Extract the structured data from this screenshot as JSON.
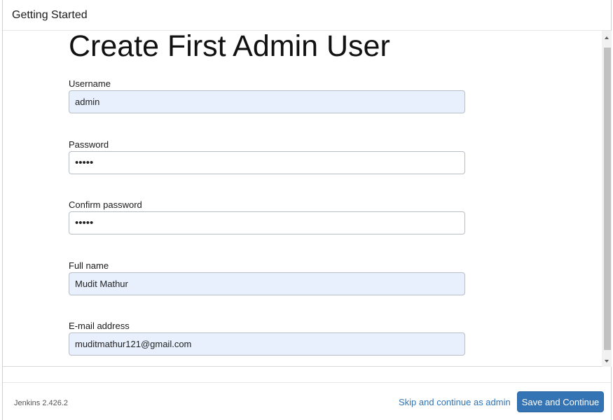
{
  "dialog": {
    "title": "Getting Started"
  },
  "form": {
    "heading": "Create First Admin User",
    "fields": [
      {
        "label": "Username",
        "value": "admin",
        "type": "text"
      },
      {
        "label": "Password",
        "value": "admin",
        "type": "password"
      },
      {
        "label": "Confirm password",
        "value": "admin",
        "type": "password"
      },
      {
        "label": "Full name",
        "value": "Mudit Mathur",
        "type": "text"
      },
      {
        "label": "E-mail address",
        "value": "muditmathur121@gmail.com",
        "type": "text"
      }
    ]
  },
  "footer": {
    "version": "Jenkins 2.426.2",
    "skip_label": "Skip and continue as admin",
    "save_label": "Save and Continue"
  },
  "colors": {
    "accent": "#3574b4",
    "link": "#2f73b5",
    "autofill_bg": "#e8f0fe"
  }
}
